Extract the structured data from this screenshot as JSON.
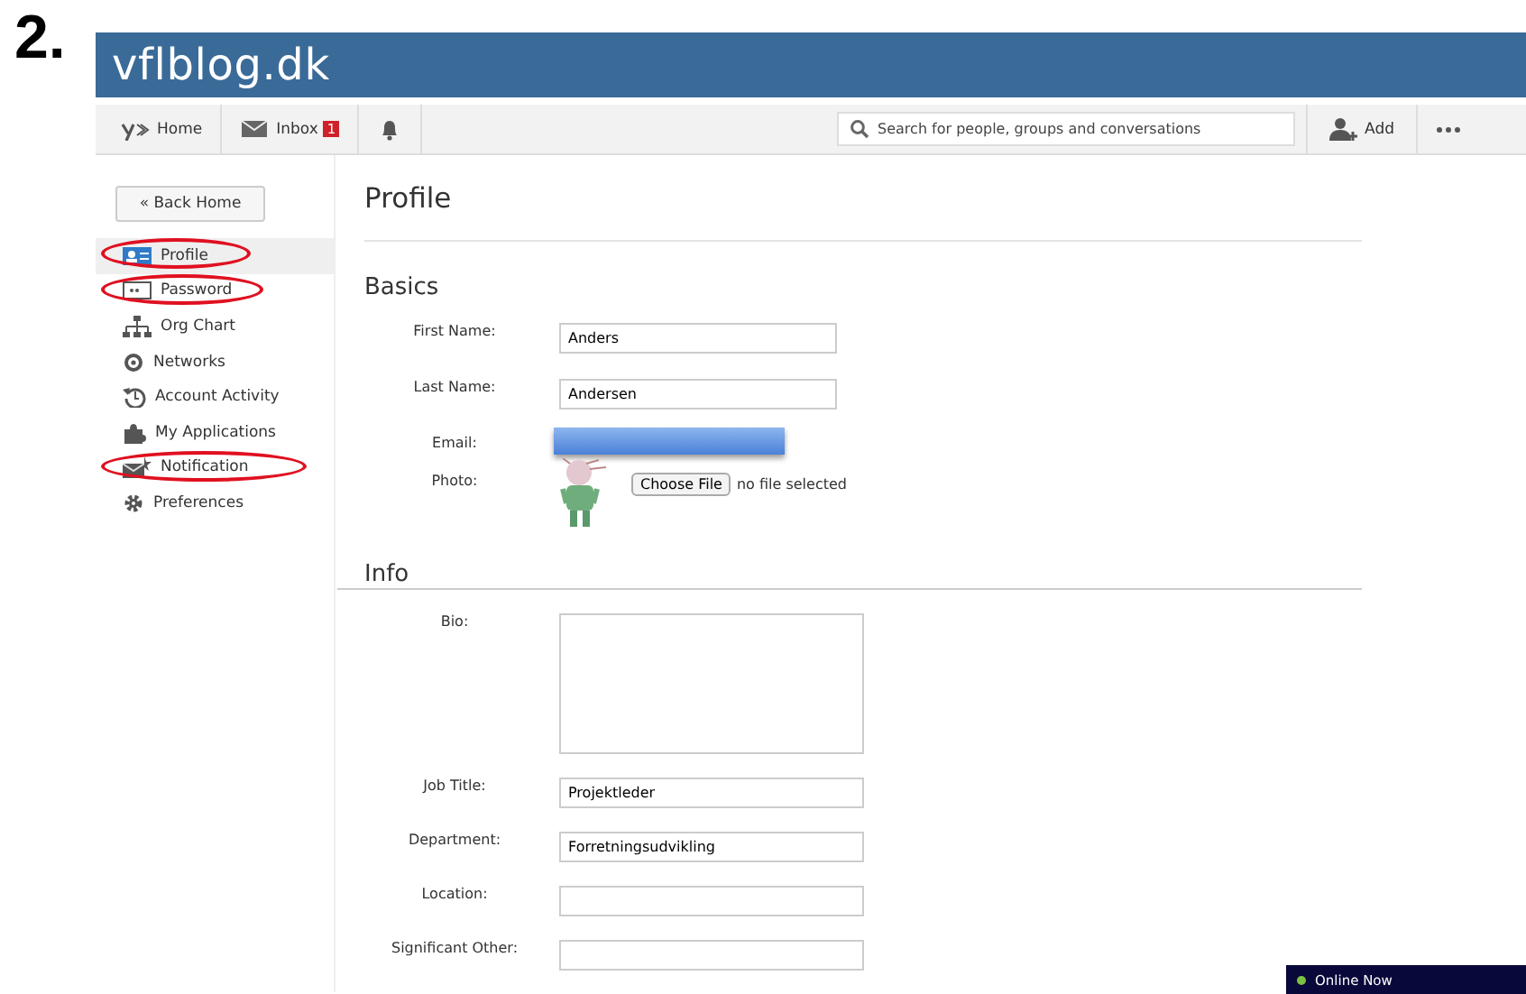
{
  "step_label": "2.",
  "site_title": "vflblog.dk",
  "nav": [
    {
      "kind": "home",
      "label": "Home"
    },
    {
      "kind": "inbox",
      "label": "Inbox",
      "badge": "1"
    },
    {
      "kind": "bell"
    }
  ],
  "search": {
    "placeholder": "Search for people, groups and conversations"
  },
  "add_button": {
    "label": "Add"
  },
  "sidebar": {
    "back_button": "« Back Home",
    "items": [
      {
        "kind": "profile",
        "label": "Profile",
        "selected": true,
        "circled": true
      },
      {
        "kind": "password",
        "label": "Password",
        "selected": false,
        "circled": true
      },
      {
        "kind": "org",
        "label": "Org Chart",
        "selected": false,
        "circled": false
      },
      {
        "kind": "networks",
        "label": "Networks",
        "selected": false,
        "circled": false
      },
      {
        "kind": "activity",
        "label": "Account Activity",
        "selected": false,
        "circled": false
      },
      {
        "kind": "apps",
        "label": "My Applications",
        "selected": false,
        "circled": false
      },
      {
        "kind": "notification",
        "label": "Notification",
        "selected": false,
        "circled": true
      },
      {
        "kind": "gear",
        "label": "Preferences",
        "selected": false,
        "circled": false
      }
    ]
  },
  "page_title": "Profile",
  "sections": [
    {
      "heading": "Basics",
      "fields": [
        {
          "kind": "text",
          "label": "First Name:",
          "value": "Anders"
        },
        {
          "kind": "text",
          "label": "Last Name:",
          "value": "Andersen"
        },
        {
          "kind": "redacted",
          "label": "Email:"
        },
        {
          "kind": "photo",
          "label": "Photo:",
          "button": "Choose File",
          "status": "no file selected"
        }
      ]
    },
    {
      "heading": "Info",
      "fields": [
        {
          "kind": "textarea",
          "label": "Bio:"
        },
        {
          "kind": "text",
          "label": "Job Title:",
          "value": "Projektleder"
        },
        {
          "kind": "text",
          "label": "Department:",
          "value": "Forretningsudvikling"
        },
        {
          "kind": "text",
          "label": "Location:"
        },
        {
          "kind": "text",
          "label": "Significant Other:"
        }
      ]
    }
  ],
  "chat_bar": {
    "label": "Online Now",
    "color": "#7ac143"
  }
}
